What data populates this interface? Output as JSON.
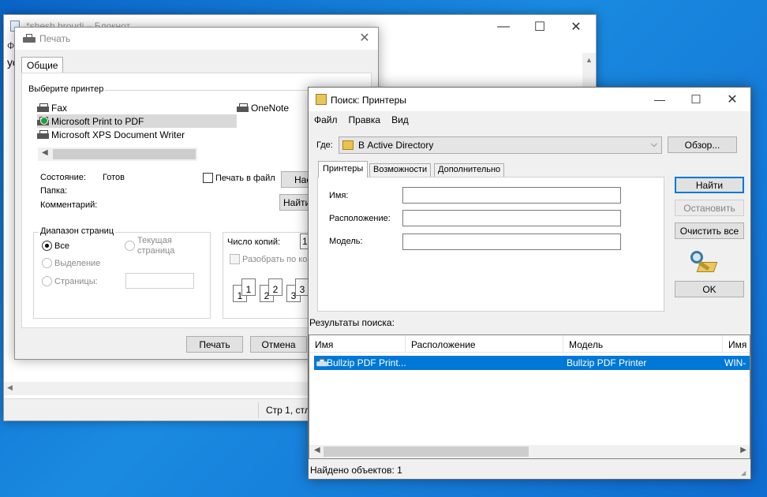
{
  "notepad": {
    "title": "*shesh broudi – Блокнот",
    "menu_fragment": "Ф",
    "text_fragment": "ус",
    "status_position": "Стр 1, стл"
  },
  "print_dialog": {
    "title": "Печать",
    "tab_general": "Общие",
    "select_printer_label": "Выберите принтер",
    "printers": [
      "Fax",
      "Microsoft Print to PDF",
      "Microsoft XPS Document Writer",
      "OneNote"
    ],
    "selected_printer": "Microsoft Print to PDF",
    "status_label": "Состояние:",
    "status_value": "Готов",
    "folder_label": "Папка:",
    "comment_label": "Комментарий:",
    "print_to_file_label": "Печать в файл",
    "preferences_button": "Настройка",
    "find_printer_button": "Найти принтер...",
    "page_range_label": "Диапазон страниц",
    "range_all": "Все",
    "range_selection": "Выделение",
    "range_current_line1": "Текущая",
    "range_current_line2": "страница",
    "range_pages": "Страницы:",
    "copies_label": "Число копий:",
    "copies_value": "1",
    "collate_label": "Разобрать по копиям",
    "collate_pages": [
      "1",
      "1",
      "2",
      "2",
      "3",
      "3"
    ],
    "print_button": "Печать",
    "cancel_button": "Отмена"
  },
  "search_dialog": {
    "title": "Поиск: Принтеры",
    "menu": [
      "Файл",
      "Правка",
      "Вид"
    ],
    "where_label": "Где:",
    "where_value": "В Active Directory",
    "browse_button": "Обзор...",
    "tabs": [
      "Принтеры",
      "Возможности",
      "Дополнительно"
    ],
    "active_tab": "Принтеры",
    "fields": {
      "name_label": "Имя:",
      "location_label": "Расположение:",
      "model_label": "Модель:"
    },
    "find_now_button": "Найти",
    "stop_button": "Остановить",
    "clear_all_button": "Очистить все",
    "ok_button": "OK",
    "results_label": "Результаты поиска:",
    "columns": [
      "Имя",
      "Расположение",
      "Модель",
      "Имя с"
    ],
    "rows": [
      {
        "name": "Bullzip PDF Print...",
        "location": "",
        "model": "Bullzip PDF Printer",
        "server": "WIN-"
      }
    ],
    "status": "Найдено объектов: 1"
  }
}
